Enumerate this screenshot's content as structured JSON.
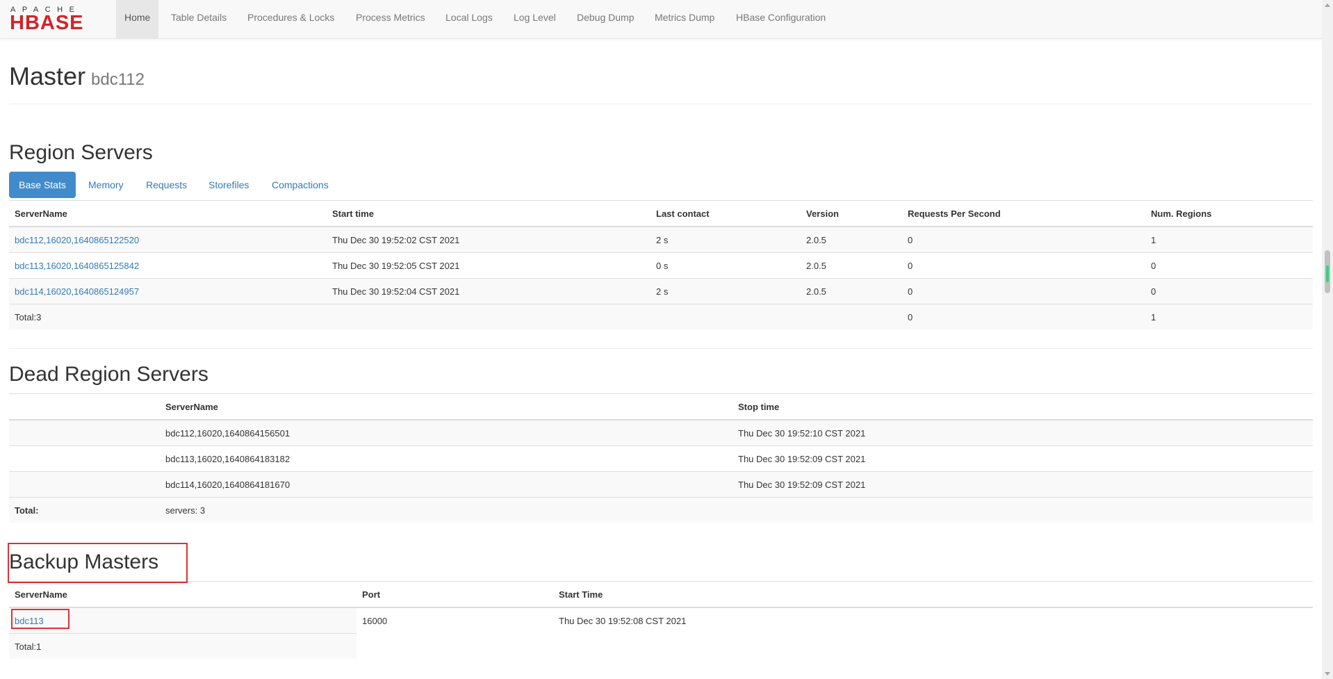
{
  "brand": {
    "logo_top": "APACHE",
    "logo_main": "HBASE",
    "colors": {
      "logo_red": "#d2232a",
      "accent": "#428bca",
      "link": "#337ab7",
      "highlight": "#e03131"
    }
  },
  "nav": {
    "items": [
      {
        "label": "Home"
      },
      {
        "label": "Table Details"
      },
      {
        "label": "Procedures & Locks"
      },
      {
        "label": "Process Metrics"
      },
      {
        "label": "Local Logs"
      },
      {
        "label": "Log Level"
      },
      {
        "label": "Debug Dump"
      },
      {
        "label": "Metrics Dump"
      },
      {
        "label": "HBase Configuration"
      }
    ]
  },
  "header": {
    "title": "Master",
    "subtitle": "bdc112"
  },
  "region_servers": {
    "title": "Region Servers",
    "tabs": [
      {
        "label": "Base Stats"
      },
      {
        "label": "Memory"
      },
      {
        "label": "Requests"
      },
      {
        "label": "Storefiles"
      },
      {
        "label": "Compactions"
      }
    ],
    "columns": [
      "ServerName",
      "Start time",
      "Last contact",
      "Version",
      "Requests Per Second",
      "Num. Regions"
    ],
    "rows": [
      {
        "server": "bdc112,16020,1640865122520",
        "start": "Thu Dec 30 19:52:02 CST 2021",
        "contact": "2 s",
        "version": "2.0.5",
        "rps": "0",
        "regions": "1"
      },
      {
        "server": "bdc113,16020,1640865125842",
        "start": "Thu Dec 30 19:52:05 CST 2021",
        "contact": "0 s",
        "version": "2.0.5",
        "rps": "0",
        "regions": "0"
      },
      {
        "server": "bdc114,16020,1640865124957",
        "start": "Thu Dec 30 19:52:04 CST 2021",
        "contact": "2 s",
        "version": "2.0.5",
        "rps": "0",
        "regions": "0"
      }
    ],
    "total": {
      "label": "Total:3",
      "rps": "0",
      "regions": "1"
    }
  },
  "dead_servers": {
    "title": "Dead Region Servers",
    "columns": [
      "",
      "ServerName",
      "Stop time"
    ],
    "rows": [
      {
        "server": "bdc112,16020,1640864156501",
        "stop": "Thu Dec 30 19:52:10 CST 2021"
      },
      {
        "server": "bdc113,16020,1640864183182",
        "stop": "Thu Dec 30 19:52:09 CST 2021"
      },
      {
        "server": "bdc114,16020,1640864181670",
        "stop": "Thu Dec 30 19:52:09 CST 2021"
      }
    ],
    "total": {
      "label": "Total:",
      "value": "servers: 3"
    }
  },
  "backup_masters": {
    "title": "Backup Masters",
    "columns": [
      "ServerName",
      "Port",
      "Start Time"
    ],
    "rows": [
      {
        "server": "bdc113",
        "port": "16000",
        "start": "Thu Dec 30 19:52:08 CST 2021"
      }
    ],
    "total": "Total:1"
  }
}
